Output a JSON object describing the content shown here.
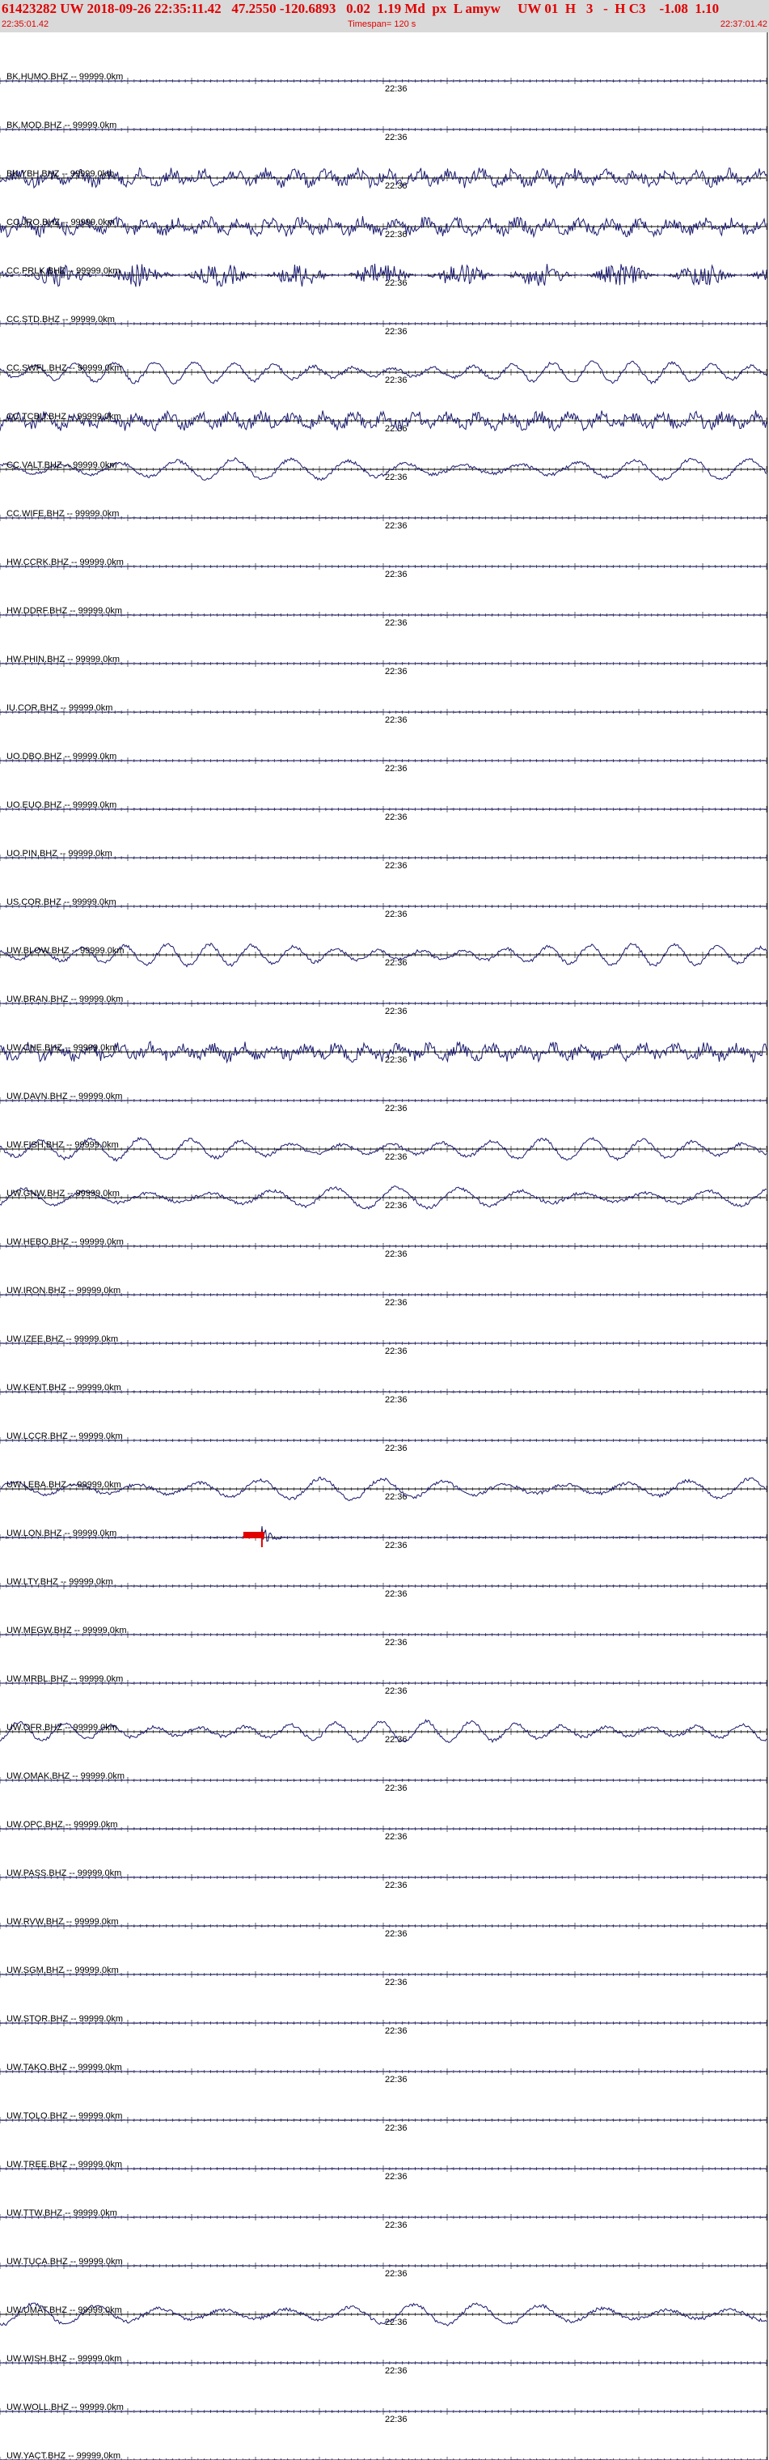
{
  "header": {
    "title": "61423282 UW 2018-09-26 22:35:11.42   47.2550 -120.6893   0.02  1.19 Md  px  L amyw     UW 01  H   3   -  H C3    -1.08  1.10",
    "start_time": "22:35:01.42",
    "timespan": "Timespan= 120 s",
    "end_time": "22:37:01.42"
  },
  "chart_data": {
    "type": "line",
    "x_unit": "s",
    "x_range": [
      0,
      120
    ],
    "center_tick_label": "22:36",
    "series": [
      {
        "name": "BK.HUMO.BHZ -- 99999.0km",
        "activity": "flat"
      },
      {
        "name": "BK.MOD.BHZ -- 99999.0km",
        "activity": "flat"
      },
      {
        "name": "BK.YBH.BHZ -- 99999.0km",
        "activity": "noisy"
      },
      {
        "name": "CC.JRO.BHZ -- 99999.0km",
        "activity": "noisy"
      },
      {
        "name": "CC.PRLK.BHZ -- 99999.0km",
        "activity": "packets"
      },
      {
        "name": "CC.STD.BHZ -- 99999.0km",
        "activity": "flat"
      },
      {
        "name": "CC.SWFL.BHZ -- 99999.0km",
        "activity": "wave"
      },
      {
        "name": "CC.TCBU.BHZ -- 99999.0km",
        "activity": "noisy"
      },
      {
        "name": "CC.VALT.BHZ -- 99999.0km",
        "activity": "wave"
      },
      {
        "name": "CC.WIFE.BHZ -- 99999.0km",
        "activity": "flat"
      },
      {
        "name": "HW.CCRK.BHZ -- 99999.0km",
        "activity": "flat"
      },
      {
        "name": "HW.DDRF.BHZ -- 99999.0km",
        "activity": "flat"
      },
      {
        "name": "HW.PHIN.BHZ -- 99999.0km",
        "activity": "flat"
      },
      {
        "name": "IU.COR.BHZ -- 99999.0km",
        "activity": "flat"
      },
      {
        "name": "UO.DBO.BHZ -- 99999.0km",
        "activity": "flat"
      },
      {
        "name": "UO.EUO.BHZ -- 99999.0km",
        "activity": "flat"
      },
      {
        "name": "UO.PIN.BHZ -- 99999.0km",
        "activity": "flat"
      },
      {
        "name": "US.COR.BHZ -- 99999.0km",
        "activity": "flat"
      },
      {
        "name": "UW.BLOW.BHZ -- 99999.0km",
        "activity": "wave"
      },
      {
        "name": "UW.BRAN.BHZ -- 99999.0km",
        "activity": "flat"
      },
      {
        "name": "UW.CHE.BHZ -- 99999.0km",
        "activity": "noisy"
      },
      {
        "name": "UW.DAVN.BHZ -- 99999.0km",
        "activity": "flat"
      },
      {
        "name": "UW.FISH.BHZ -- 99999.0km",
        "activity": "wave"
      },
      {
        "name": "UW.GNW.BHZ -- 99999.0km",
        "activity": "wave"
      },
      {
        "name": "UW.HEBO.BHZ -- 99999.0km",
        "activity": "flat"
      },
      {
        "name": "UW.IRON.BHZ -- 99999.0km",
        "activity": "flat"
      },
      {
        "name": "UW.IZEE.BHZ -- 99999.0km",
        "activity": "flat"
      },
      {
        "name": "UW.KENT.BHZ -- 99999.0km",
        "activity": "flat"
      },
      {
        "name": "UW.LCCR.BHZ -- 99999.0km",
        "activity": "flat"
      },
      {
        "name": "UW.LEBA.BHZ -- 99999.0km",
        "activity": "wave"
      },
      {
        "name": "UW.LON.BHZ -- 99999.0km",
        "activity": "event"
      },
      {
        "name": "UW.LTY.BHZ -- 99999.0km",
        "activity": "flat"
      },
      {
        "name": "UW.MEGW.BHZ -- 99999.0km",
        "activity": "flat"
      },
      {
        "name": "UW.MRBL.BHZ -- 99999.0km",
        "activity": "flat"
      },
      {
        "name": "UW.OFR.BHZ -- 99999.0km",
        "activity": "wave"
      },
      {
        "name": "UW.OMAK.BHZ -- 99999.0km",
        "activity": "flat"
      },
      {
        "name": "UW.OPC.BHZ -- 99999.0km",
        "activity": "flat"
      },
      {
        "name": "UW.PASS.BHZ -- 99999.0km",
        "activity": "flat"
      },
      {
        "name": "UW.RVW.BHZ -- 99999.0km",
        "activity": "flat"
      },
      {
        "name": "UW.SGM.BHZ -- 99999.0km",
        "activity": "flat"
      },
      {
        "name": "UW.STOR.BHZ -- 99999.0km",
        "activity": "flat"
      },
      {
        "name": "UW.TAKO.BHZ -- 99999.0km",
        "activity": "flat"
      },
      {
        "name": "UW.TOLO.BHZ -- 99999.0km",
        "activity": "flat"
      },
      {
        "name": "UW.TREE.BHZ -- 99999.0km",
        "activity": "flat"
      },
      {
        "name": "UW.TTW.BHZ -- 99999.0km",
        "activity": "flat"
      },
      {
        "name": "UW.TUCA.BHZ -- 99999.0km",
        "activity": "flat"
      },
      {
        "name": "UW.UMAT.BHZ -- 99999.0km",
        "activity": "wave"
      },
      {
        "name": "UW.WISH.BHZ -- 99999.0km",
        "activity": "flat"
      },
      {
        "name": "UW.WOLL.BHZ -- 99999.0km",
        "activity": "flat"
      },
      {
        "name": "UW.YACT.BHZ -- 99999.0km",
        "activity": "flat"
      }
    ],
    "pick": {
      "series": "UW.LON.BHZ -- 99999.0km",
      "time_s": 41,
      "color": "#e00000"
    },
    "trace_color": "#1a1a6e",
    "label_color": "#000000",
    "pick_color": "#e00000"
  }
}
